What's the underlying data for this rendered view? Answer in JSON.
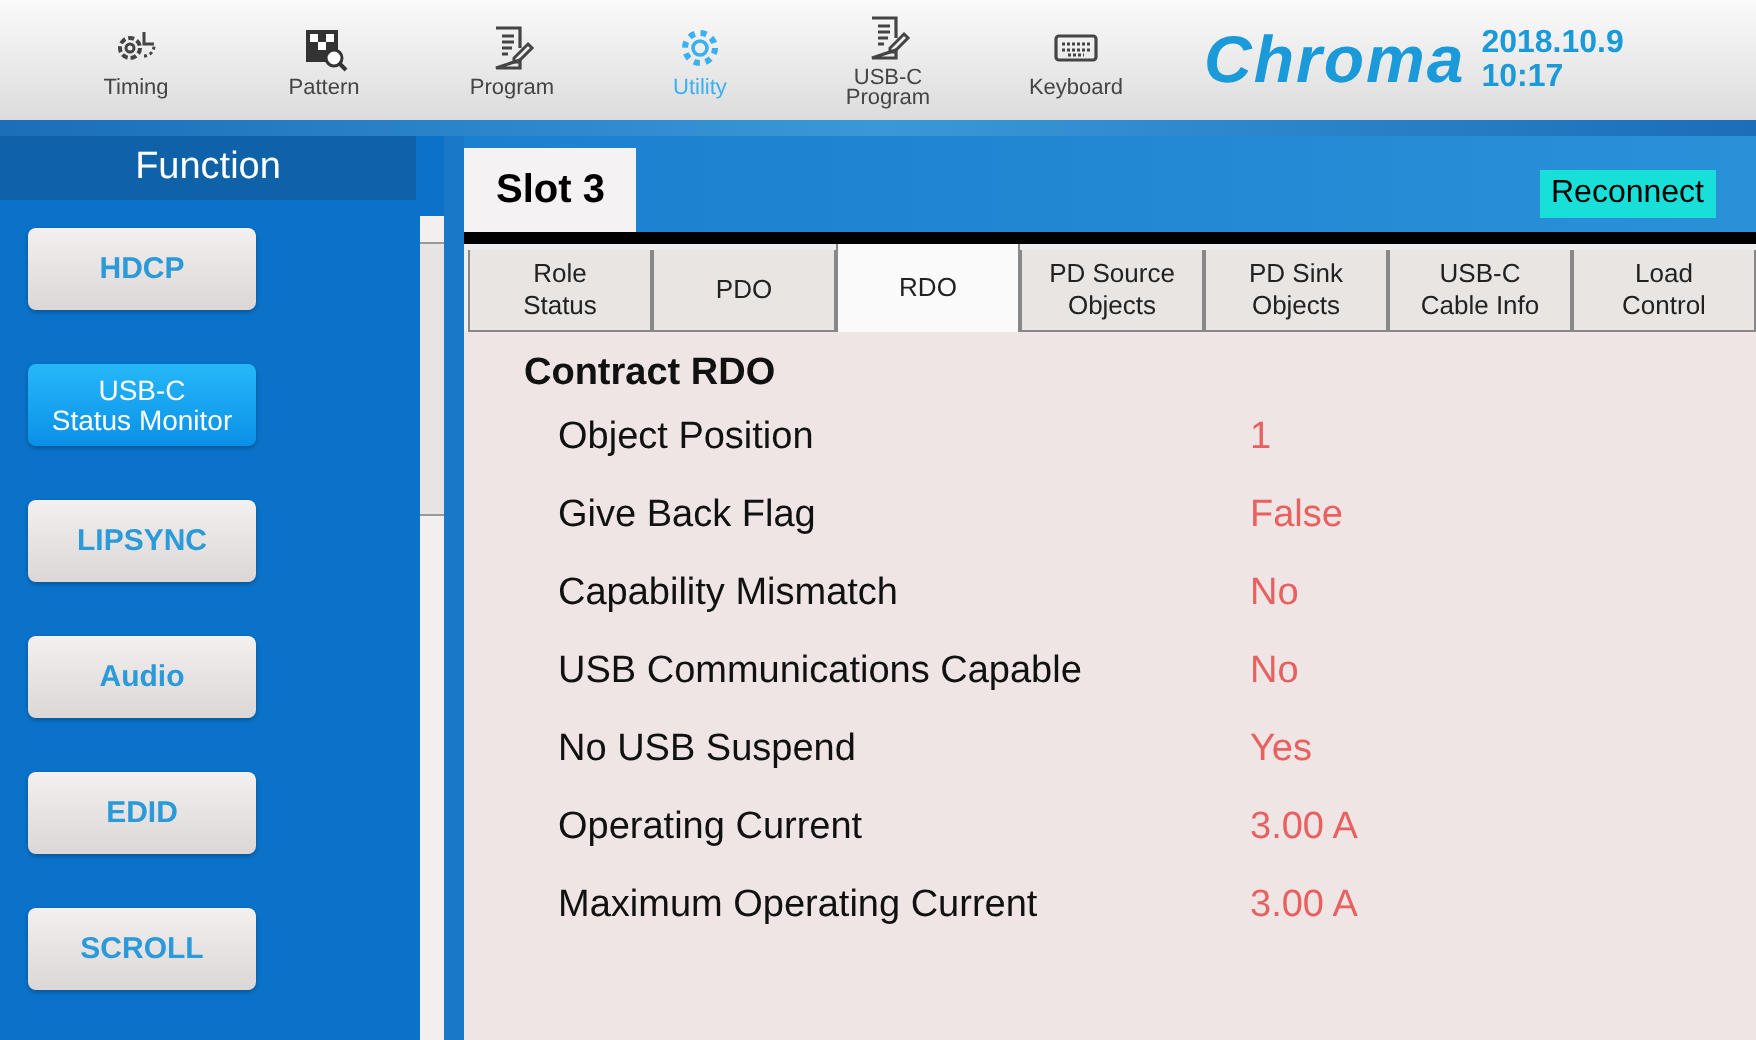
{
  "toolbar": {
    "items": [
      {
        "label": "Timing",
        "kind": "timing",
        "selected": false
      },
      {
        "label": "Pattern",
        "kind": "pattern",
        "selected": false
      },
      {
        "label": "Program",
        "kind": "program",
        "selected": false
      },
      {
        "label": "Utility",
        "kind": "utility",
        "selected": true
      },
      {
        "label": "USB-C\nProgram",
        "kind": "program",
        "selected": false
      },
      {
        "label": "Keyboard",
        "kind": "keyboard",
        "selected": false
      }
    ],
    "logo": "Chroma",
    "date": "2018.10.9",
    "time": "10:17"
  },
  "sidebar": {
    "title": "Function",
    "items": [
      {
        "label": "HDCP",
        "selected": false
      },
      {
        "label": "USB-C\nStatus Monitor",
        "selected": true
      },
      {
        "label": "LIPSYNC",
        "selected": false
      },
      {
        "label": "Audio",
        "selected": false
      },
      {
        "label": "EDID",
        "selected": false
      },
      {
        "label": "SCROLL",
        "selected": false
      }
    ]
  },
  "slot": {
    "label": "Slot 3"
  },
  "reconnect_button": "Reconnect",
  "tabs": [
    {
      "label": "Role\nStatus",
      "selected": false
    },
    {
      "label": "PDO",
      "selected": false
    },
    {
      "label": "RDO",
      "selected": true
    },
    {
      "label": "PD Source\nObjects",
      "selected": false
    },
    {
      "label": "PD Sink\nObjects",
      "selected": false
    },
    {
      "label": "USB-C\nCable Info",
      "selected": false
    },
    {
      "label": "Load\nControl",
      "selected": false
    }
  ],
  "section_title": "Contract RDO",
  "fields": [
    {
      "label": "Object Position",
      "value": "1"
    },
    {
      "label": "Give Back Flag",
      "value": "False"
    },
    {
      "label": "Capability Mismatch",
      "value": "No"
    },
    {
      "label": "USB Communications Capable",
      "value": "No"
    },
    {
      "label": "No USB Suspend",
      "value": "Yes"
    },
    {
      "label": "Operating Current",
      "value": "3.00 A"
    },
    {
      "label": "Maximum Operating Current",
      "value": "3.00 A"
    }
  ]
}
